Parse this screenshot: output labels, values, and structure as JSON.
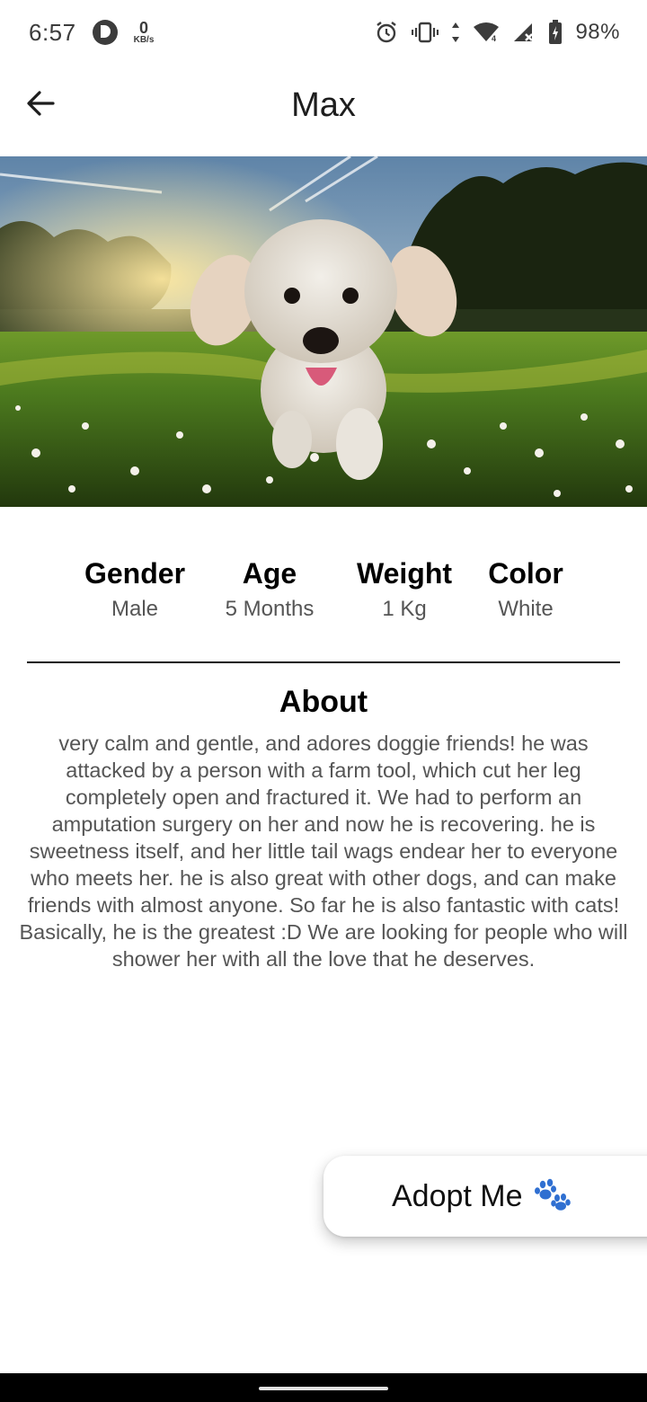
{
  "status_bar": {
    "time": "6:57",
    "net_speed_value": "0",
    "net_speed_unit": "KB/s",
    "battery": "98%",
    "icons": [
      "p-app-icon",
      "alarm-icon",
      "vibrate-icon",
      "data-arrows-icon",
      "wifi-icon",
      "cell-signal-icon",
      "battery-icon"
    ]
  },
  "app_bar": {
    "title": "Max",
    "back_icon": "arrow-left-icon"
  },
  "hero": {
    "description_icon": "dog-photo"
  },
  "stats": [
    {
      "label": "Gender",
      "value": "Male"
    },
    {
      "label": "Age",
      "value": "5 Months"
    },
    {
      "label": "Weight",
      "value": "1 Kg"
    },
    {
      "label": "Color",
      "value": "White"
    }
  ],
  "about": {
    "title": "About",
    "text": "very calm and gentle, and adores doggie friends! he was attacked by a person with a farm tool, which cut her leg completely open and fractured it. We had to perform an amputation surgery on her and now he is recovering. he is sweetness itself, and her little tail wags endear her to everyone who meets her. he is also great with other dogs, and can make friends with almost anyone. So far he is also fantastic with cats! Basically, he is the greatest :D We are looking for people who will shower her with all the love that he deserves."
  },
  "adopt_button": {
    "label": "Adopt Me",
    "icon": "paw-icon",
    "icon_color": "#2f6fd1"
  },
  "colors": {
    "background": "#ffffff",
    "text_primary": "#000000",
    "text_secondary": "#555555"
  }
}
